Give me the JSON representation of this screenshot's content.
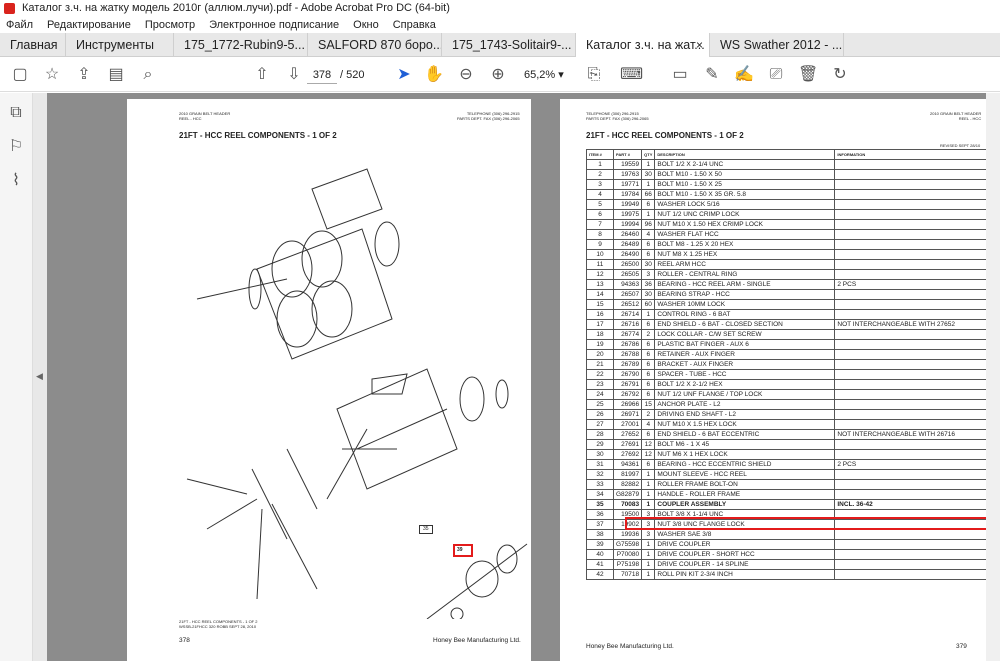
{
  "window": {
    "title": "Каталог з.ч. на жатку модель 2010г (аллюм.лучи).pdf - Adobe Acrobat Pro DC (64-bit)"
  },
  "menu": [
    "Файл",
    "Редактирование",
    "Просмотр",
    "Электронное подписание",
    "Окно",
    "Справка"
  ],
  "tabs": [
    {
      "label": "Главная"
    },
    {
      "label": "Инструменты"
    },
    {
      "label": "175_1772-Rubin9-5..."
    },
    {
      "label": "SALFORD 870 боро..."
    },
    {
      "label": "175_1743-Solitair9-..."
    },
    {
      "label": "Каталог з.ч. на жат...",
      "close": "×"
    },
    {
      "label": "WS Swather 2012 - ..."
    }
  ],
  "toolbar": {
    "page_current": "378",
    "page_total": "/ 520",
    "zoom": "65,2%",
    "zoom_arrow": "▾"
  },
  "left_page": {
    "header_left": "2010 GRAIN BELT HEADER\nREEL - HCC",
    "header_right": "TELEPHONE (306) 296-2915\nPARTS DEPT. FAX (306) 296-2065",
    "title": "21FT - HCC REEL COMPONENTS - 1 OF 2",
    "footer_left": "378",
    "footer_right": "Honey Bee Manufacturing Ltd.",
    "callout_35": "35",
    "callout_39": "39",
    "footnote": "21FT - HCC REEL COMPONENTS - 1 OF 2\nWSSB-21FHCC 320 ROBB SEPT 28, 2010"
  },
  "right_page": {
    "header_left": "TELEPHONE (306) 296-2915\nPARTS DEPT. FAX (306) 296-2065",
    "header_right": "2010 GRAIN BELT HEADER\nREEL - HCC",
    "title": "21FT - HCC REEL COMPONENTS - 1 OF 2",
    "revised": "REVISED SEPT 28/10",
    "footer_left": "Honey Bee Manufacturing Ltd.",
    "footer_right": "379",
    "columns": [
      "ITEM #",
      "PART #",
      "QTY",
      "DESCRIPTION",
      "INFORMATION"
    ],
    "rows": [
      [
        "1",
        "19559",
        "1",
        "BOLT 1/2 X 2-1/4 UNC",
        ""
      ],
      [
        "2",
        "19763",
        "30",
        "BOLT M10 - 1.50 X 50",
        ""
      ],
      [
        "3",
        "19771",
        "1",
        "BOLT M10 - 1.50 X 25",
        ""
      ],
      [
        "4",
        "19784",
        "66",
        "BOLT M10 - 1.50 X 35 GR. 5.8",
        ""
      ],
      [
        "5",
        "19949",
        "6",
        "WASHER LOCK 5/16",
        ""
      ],
      [
        "6",
        "19975",
        "1",
        "NUT 1/2 UNC CRIMP LOCK",
        ""
      ],
      [
        "7",
        "19994",
        "96",
        "NUT M10 X 1.50 HEX CRIMP LOCK",
        ""
      ],
      [
        "8",
        "26460",
        "4",
        "WASHER FLAT HCC",
        ""
      ],
      [
        "9",
        "26489",
        "6",
        "BOLT M8 - 1.25 X 20 HEX",
        ""
      ],
      [
        "10",
        "26490",
        "6",
        "NUT M8 X 1.25 HEX",
        ""
      ],
      [
        "11",
        "26500",
        "30",
        "REEL ARM HCC",
        ""
      ],
      [
        "12",
        "26505",
        "3",
        "ROLLER - CENTRAL RING",
        ""
      ],
      [
        "13",
        "94363",
        "36",
        "BEARING - HCC REEL ARM - SINGLE",
        "2 PCS"
      ],
      [
        "14",
        "26507",
        "30",
        "BEARING STRAP - HCC",
        ""
      ],
      [
        "15",
        "26512",
        "60",
        "WASHER 10MM LOCK",
        ""
      ],
      [
        "16",
        "26714",
        "1",
        "CONTROL RING - 6 BAT",
        ""
      ],
      [
        "17",
        "26716",
        "6",
        "END SHIELD - 6 BAT - CLOSED SECTION",
        "NOT INTERCHANGEABLE WITH 27652"
      ],
      [
        "18",
        "26774",
        "2",
        "LOCK COLLAR - C/W SET SCREW",
        ""
      ],
      [
        "19",
        "26786",
        "6",
        "PLASTIC BAT FINGER - AUX 6",
        ""
      ],
      [
        "20",
        "26788",
        "6",
        "RETAINER - AUX FINGER",
        ""
      ],
      [
        "21",
        "26789",
        "6",
        "BRACKET - AUX FINGER",
        ""
      ],
      [
        "22",
        "26790",
        "6",
        "SPACER - TUBE - HCC",
        ""
      ],
      [
        "23",
        "26791",
        "6",
        "BOLT 1/2 X 2-1/2 HEX",
        ""
      ],
      [
        "24",
        "26792",
        "6",
        "NUT 1/2 UNF FLANGE / TOP LOCK",
        ""
      ],
      [
        "25",
        "26966",
        "15",
        "ANCHOR PLATE - L2",
        ""
      ],
      [
        "26",
        "26971",
        "2",
        "DRIVING END SHAFT - L2",
        ""
      ],
      [
        "27",
        "27001",
        "4",
        "NUT M10 X 1.5 HEX LOCK",
        ""
      ],
      [
        "28",
        "27652",
        "6",
        "END SHIELD - 6 BAT ECCENTRIC",
        "NOT INTERCHANGEABLE WITH 26716"
      ],
      [
        "29",
        "27691",
        "12",
        "BOLT M6 - 1 X 45",
        ""
      ],
      [
        "30",
        "27692",
        "12",
        "NUT M6 X 1 HEX LOCK",
        ""
      ],
      [
        "31",
        "94361",
        "6",
        "BEARING - HCC ECCENTRIC SHIELD",
        "2 PCS"
      ],
      [
        "32",
        "81997",
        "1",
        "MOUNT SLEEVE - HCC REEL",
        ""
      ],
      [
        "33",
        "82882",
        "1",
        "ROLLER FRAME BOLT-ON",
        ""
      ],
      [
        "34",
        "G82879",
        "1",
        "HANDLE - ROLLER FRAME",
        ""
      ],
      [
        "35",
        "70083",
        "1",
        "COUPLER ASSEMBLY",
        "INCL. 36-42"
      ],
      [
        "36",
        "19500",
        "3",
        "BOLT 3/8 X 1-1/4 UNC",
        ""
      ],
      [
        "37",
        "19902",
        "3",
        "NUT 3/8 UNC FLANGE LOCK",
        ""
      ],
      [
        "38",
        "19936",
        "3",
        "WASHER SAE 3/8",
        ""
      ],
      [
        "39",
        "G75598",
        "1",
        "DRIVE COUPLER",
        ""
      ],
      [
        "40",
        "P70080",
        "1",
        "DRIVE COUPLER - SHORT HCC",
        ""
      ],
      [
        "41",
        "P75198",
        "1",
        "DRIVE COUPLER - 14 SPLINE",
        ""
      ],
      [
        "42",
        "70718",
        "1",
        "ROLL PIN KIT 2-3/4 INCH",
        ""
      ]
    ]
  },
  "icons": {
    "save": "save-icon",
    "star": "star-icon",
    "upload": "upload-icon",
    "print": "print-icon",
    "search": "search-icon",
    "up": "page-up-icon",
    "down": "page-down-icon",
    "select": "select-arrow-icon",
    "hand": "hand-icon",
    "zoomout": "zoom-out-icon",
    "zoomin": "zoom-in-icon"
  }
}
